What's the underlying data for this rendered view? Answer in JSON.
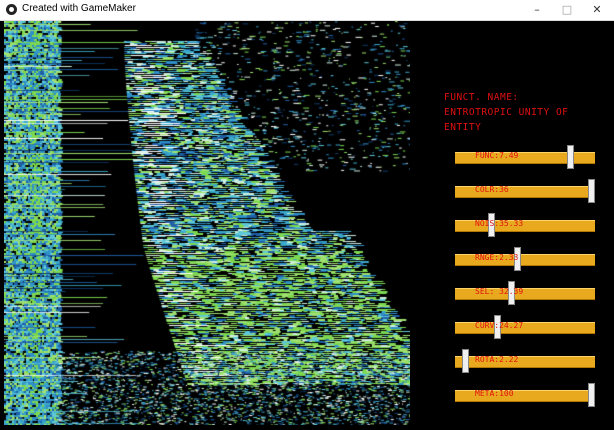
{
  "window": {
    "title": "Created with GameMaker",
    "minimize": "–",
    "maximize": "□",
    "close": "✕"
  },
  "function_name": {
    "label": "FUNCT. NAME:",
    "line1": "ENTROTROPIC UNITY OF",
    "line2": "ENTITY"
  },
  "sliders": [
    {
      "label": "FUNC:7.49",
      "value_fraction": 0.84
    },
    {
      "label": "COLR:36",
      "value_fraction": 1.0
    },
    {
      "label": "NOIS:35.33",
      "value_fraction": 0.25
    },
    {
      "label": "RNGE:2.33",
      "value_fraction": 0.44
    },
    {
      "label": "SEL: 32.39",
      "value_fraction": 0.4
    },
    {
      "label": "CURV:24.27",
      "value_fraction": 0.29
    },
    {
      "label": "ROTA:2.22",
      "value_fraction": 0.05
    },
    {
      "label": "META:100",
      "value_fraction": 1.0
    }
  ],
  "colors": {
    "accent": "#e01010",
    "slider_track": "#e9a91f",
    "knob": "#f0f0f0",
    "viz_primary": "#2f8fc8",
    "viz_secondary": "#7cd84f"
  }
}
